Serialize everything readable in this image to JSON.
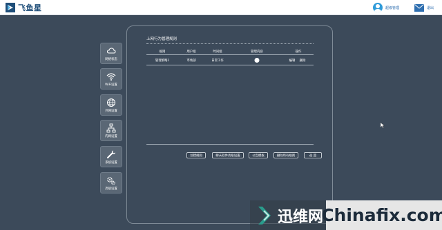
{
  "app": {
    "logo_text": "飞鱼星"
  },
  "header": {
    "user_name": "超级管理",
    "logout_label": "退出"
  },
  "sidebar": {
    "items": [
      {
        "label": "网络状态",
        "icon": "cloud-icon"
      },
      {
        "label": "WiFi设置",
        "icon": "wifi-icon"
      },
      {
        "label": "外网设置",
        "icon": "globe-icon"
      },
      {
        "label": "内网设置",
        "icon": "network-icon"
      },
      {
        "label": "系统设置",
        "icon": "wrench-icon"
      },
      {
        "label": "高级设置",
        "icon": "gears-icon"
      }
    ]
  },
  "panel": {
    "title": "上网行为管理规则",
    "columns": [
      "规则",
      "用户组",
      "时间组",
      "管理内容",
      "操作"
    ],
    "rows": [
      {
        "rule": "管理策略1",
        "user_group": "市场部",
        "time_group": "日常工作",
        "manage_icon": "info-bubble-icon",
        "edit": "编辑",
        "delete": "删除"
      }
    ],
    "buttons": {
      "create": "创建规则",
      "software_settings": "聊天软件高级设置",
      "announcement": "公告模板",
      "delete_all": "删除所有规则",
      "back": "返 回"
    }
  },
  "watermark": {
    "cn_text": "迅维网",
    "en_text": "Chinafix.com"
  }
}
